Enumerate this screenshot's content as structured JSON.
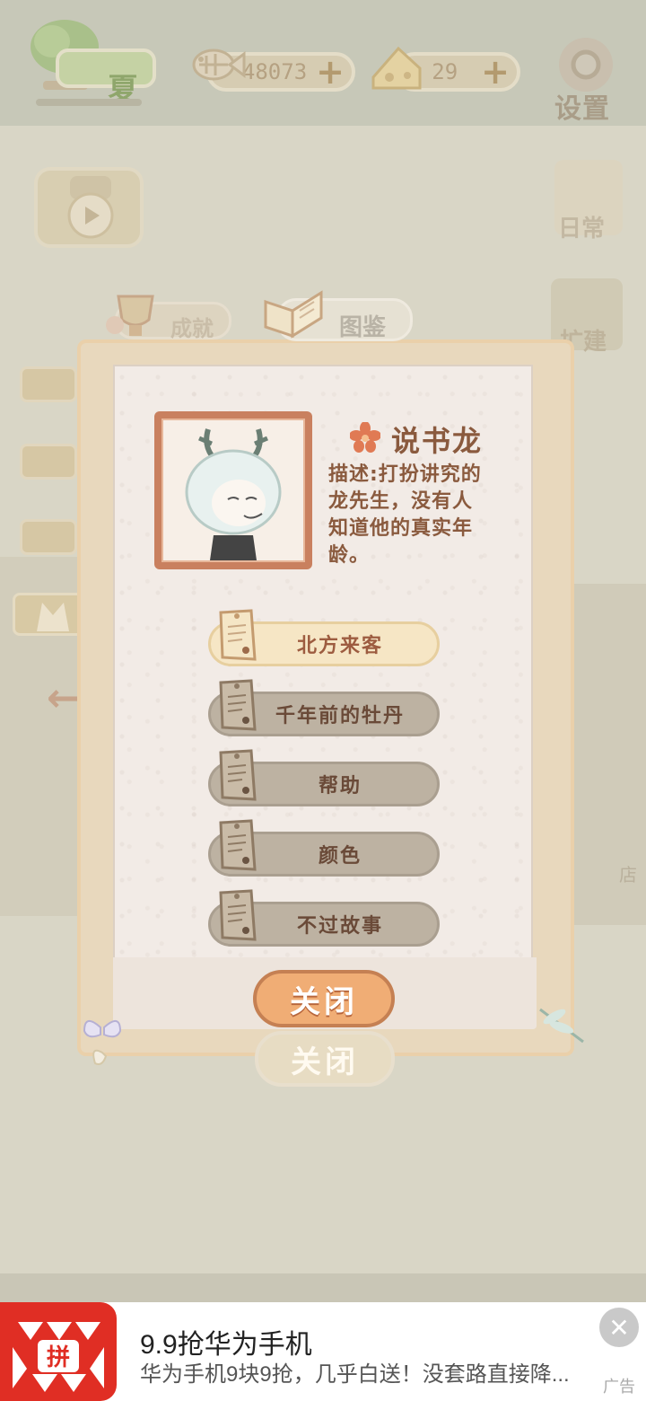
{
  "header": {
    "season_label": "夏",
    "fish_count": "48073",
    "cheese_count": "29",
    "plus_symbol": "+",
    "settings_label": "设置"
  },
  "side_menu": {
    "daily_label": "日常",
    "build_label": "扩建",
    "store_label": "店"
  },
  "tabs": {
    "achievements": "成就",
    "guide": "图鉴"
  },
  "character": {
    "name": "说书龙",
    "description": "描述:打扮讲究的\n龙先生，没有人\n知道他的真实年\n龄。"
  },
  "stories": [
    {
      "label": "北方来客",
      "state": "active"
    },
    {
      "label": "千年前的牡丹",
      "state": "locked"
    },
    {
      "label": "帮助",
      "state": "locked"
    },
    {
      "label": "颜色",
      "state": "locked"
    },
    {
      "label": "不过故事",
      "state": "locked"
    }
  ],
  "close_button": "关闭",
  "close_button_ghost": "关闭",
  "ad": {
    "logo_text": "拼",
    "title": "9.9抢华为手机",
    "subtitle": "华为手机9块9抢，几乎白送！没套路直接降...",
    "tag": "广告",
    "close_symbol": "✕"
  },
  "colors": {
    "accent_orange": "#f0ad75",
    "brown_text": "#8a5a3e",
    "ad_red": "#e02e24"
  }
}
